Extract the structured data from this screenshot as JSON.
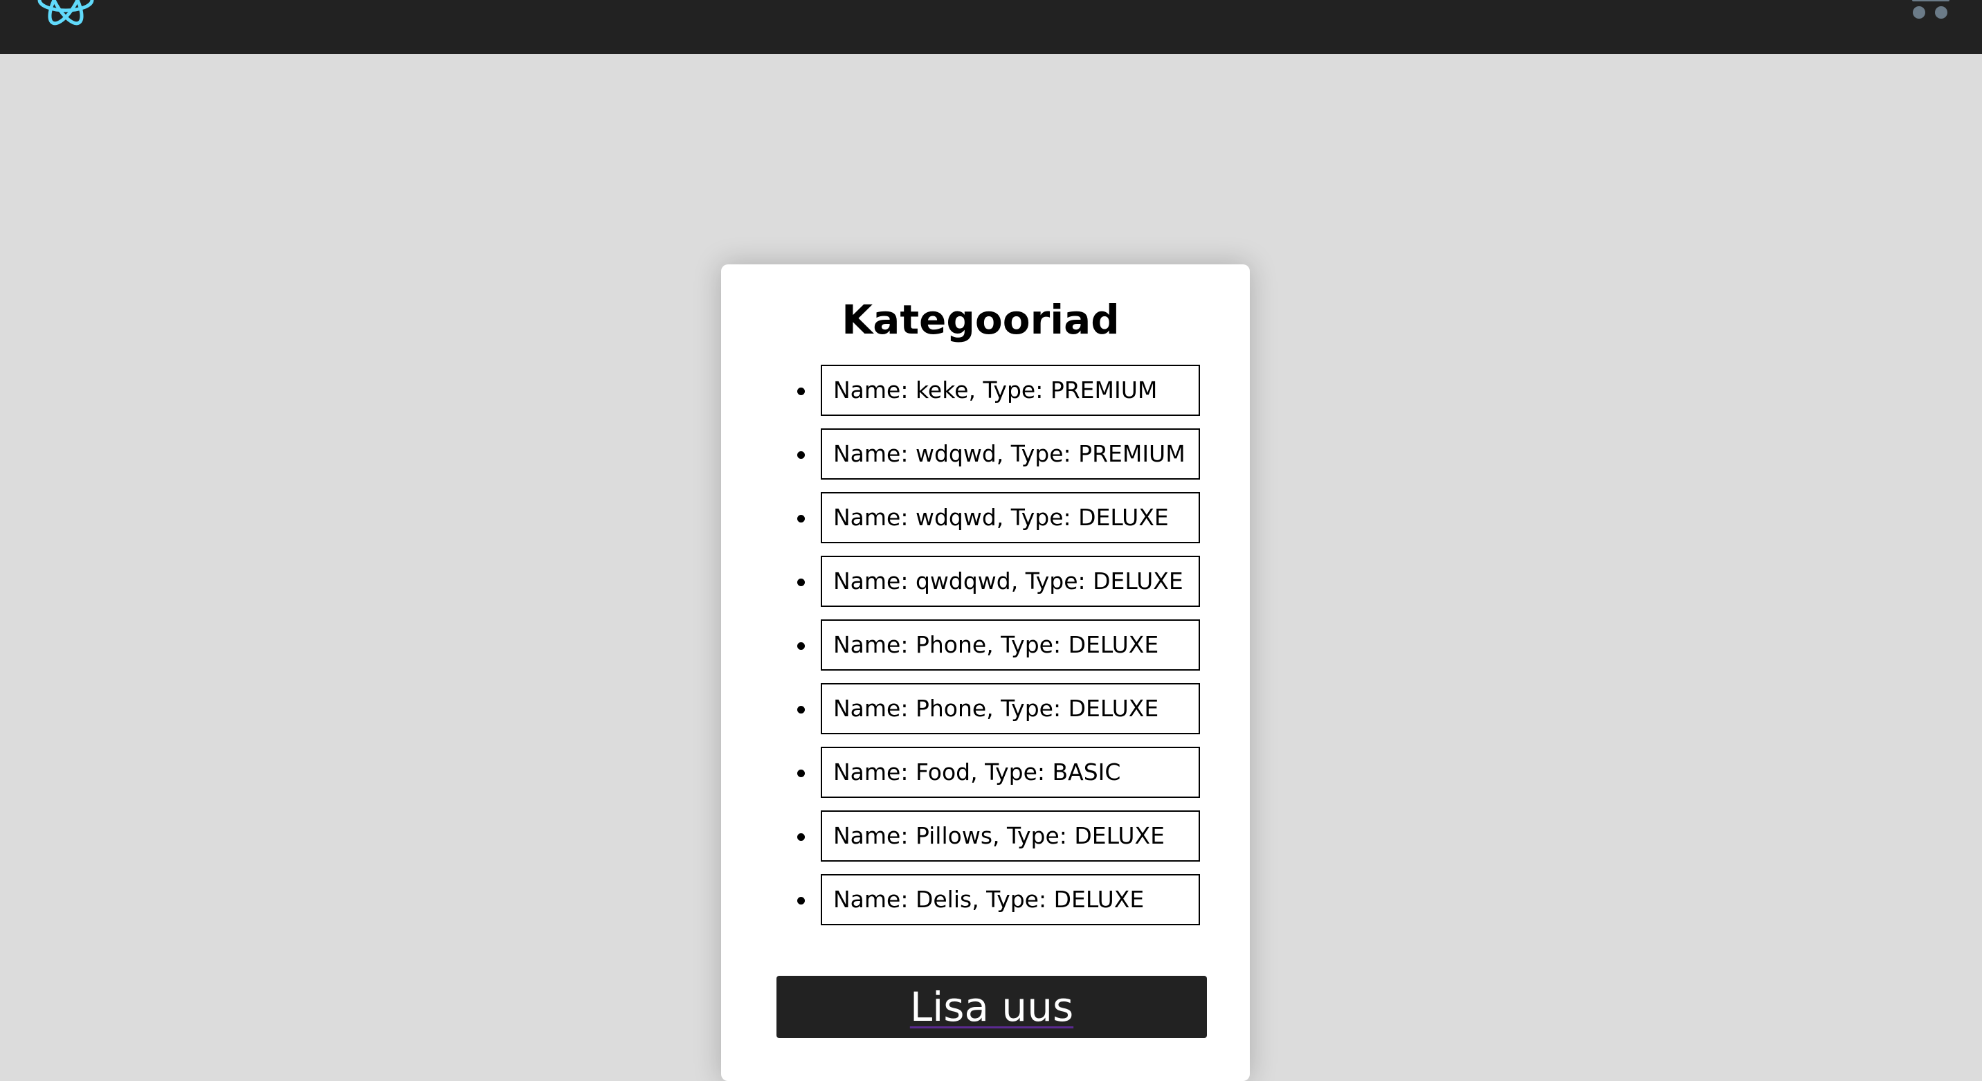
{
  "navbar": {
    "logo_icon": "react-atom-logo-icon",
    "cart_icon": "shopping-cart-icon",
    "colors": {
      "background": "#222222",
      "logo": "#61dafb",
      "cart": "#6b7b88"
    }
  },
  "card": {
    "title": "Kategooriad",
    "categories": [
      {
        "label": "Name: keke, Type: PREMIUM"
      },
      {
        "label": "Name: wdqwd, Type: PREMIUM"
      },
      {
        "label": "Name: wdqwd, Type: DELUXE"
      },
      {
        "label": "Name: qwdqwd, Type: DELUXE"
      },
      {
        "label": "Name: Phone, Type: DELUXE"
      },
      {
        "label": "Name: Phone, Type: DELUXE"
      },
      {
        "label": "Name: Food, Type: BASIC"
      },
      {
        "label": "Name: Pillows, Type: DELUXE"
      },
      {
        "label": "Name: Delis, Type: DELUXE"
      }
    ],
    "add_button_label": "Lisa uus"
  }
}
